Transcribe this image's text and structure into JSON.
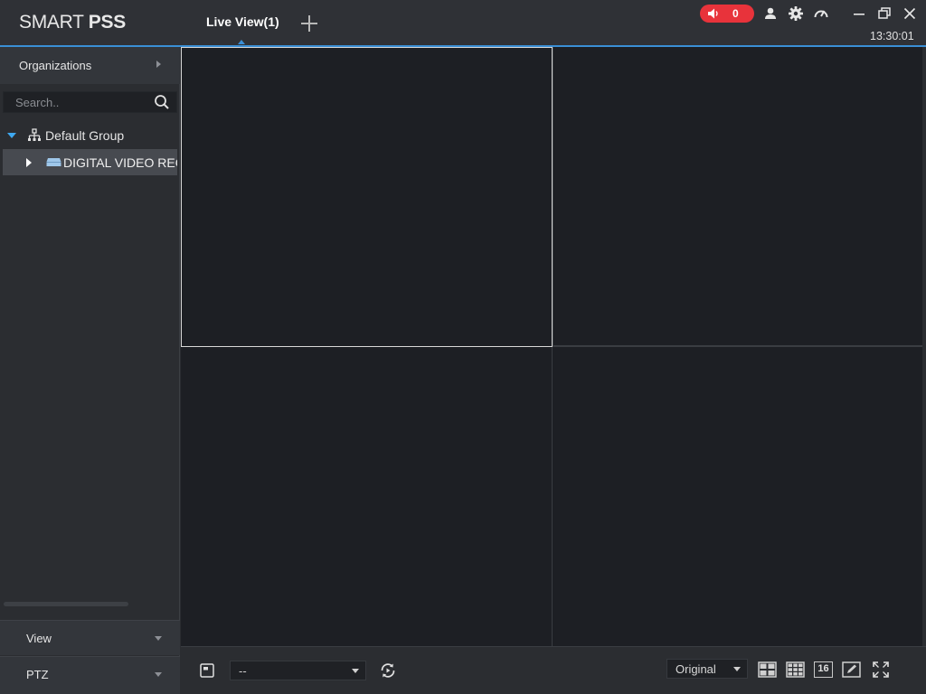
{
  "app": {
    "logo_light": "SMART ",
    "logo_bold": "PSS",
    "tab_label": "Live View(1)",
    "alarm_count": "0",
    "clock": "13:30:01",
    "accent_color": "#3a8fd6",
    "alarm_color": "#e8333b"
  },
  "sidebar": {
    "organizations_label": "Organizations",
    "search_placeholder": "Search..",
    "tree": {
      "group_label": "Default Group",
      "device_label": "DIGITAL VIDEO RECORDER"
    },
    "panels": {
      "view_label": "View",
      "ptz_label": "PTZ"
    }
  },
  "toolbar": {
    "view_select_value": "--",
    "stream_select_value": "Original",
    "layout_16_label": "16"
  },
  "icons": [
    "speaker-icon",
    "user-icon",
    "gear-icon",
    "gauge-icon",
    "minimize-icon",
    "restore-icon",
    "close-icon",
    "search-icon",
    "org-tree-icon",
    "dvr-icon",
    "save-view-icon",
    "sequence-icon",
    "layout-4-icon",
    "layout-9-icon",
    "layout-16-icon",
    "edit-layout-icon",
    "fullscreen-icon"
  ]
}
